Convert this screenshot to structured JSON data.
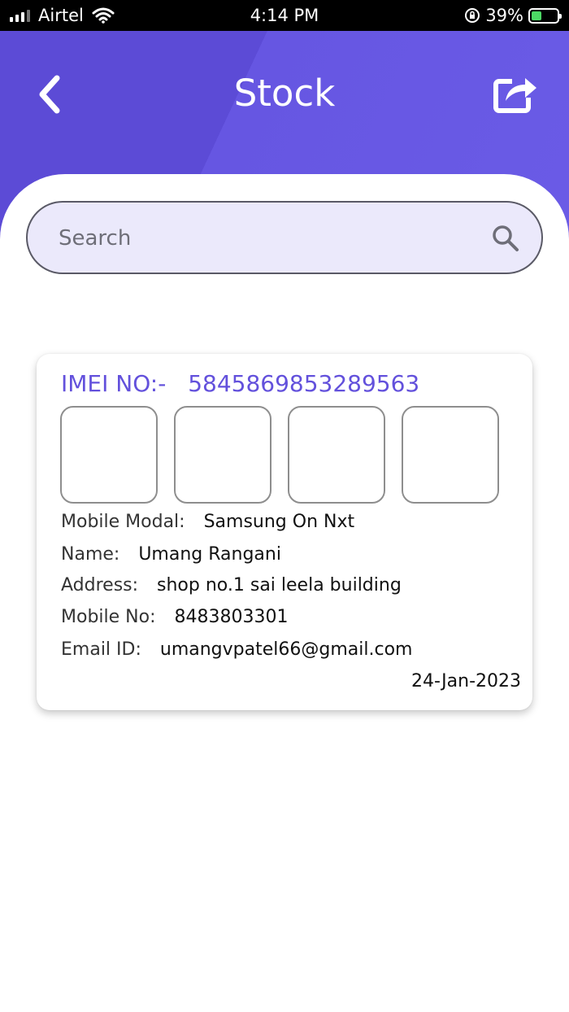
{
  "status_bar": {
    "carrier": "Airtel",
    "time": "4:14 PM",
    "battery": "39%",
    "battery_level": 0.39
  },
  "header": {
    "title": "Stock",
    "back_icon": "chevron-left-icon",
    "share_icon": "share-icon"
  },
  "search": {
    "placeholder": "Search",
    "value": ""
  },
  "card": {
    "imei_label": "IMEI NO:-",
    "imei_value": "5845869853289563",
    "details": [
      {
        "label": "Mobile Modal:",
        "value": "Samsung On Nxt"
      },
      {
        "label": "Name:",
        "value": "Umang Rangani"
      },
      {
        "label": "Address:",
        "value": "shop no.1 sai leela building"
      },
      {
        "label": "Mobile No:",
        "value": "8483803301"
      },
      {
        "label": "Email ID:",
        "value": "umangvpatel66@gmail.com"
      }
    ],
    "date": "24-Jan-2023"
  },
  "colors": {
    "accent": "#6351dc",
    "header": "#6656e2",
    "search_bg": "#ebe9fb"
  }
}
